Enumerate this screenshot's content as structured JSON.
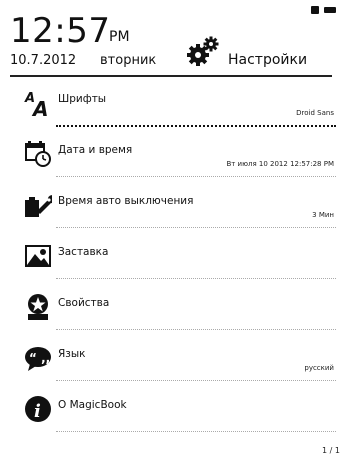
{
  "status": {
    "icons": [
      "tablet-icon",
      "battery-icon"
    ]
  },
  "clock": {
    "time": "12:57",
    "ampm": "PM"
  },
  "date": {
    "date": "10.7.2012",
    "weekday": "вторник"
  },
  "header": {
    "title": "Настройки",
    "icon": "gears-icon"
  },
  "menu": {
    "items": [
      {
        "label": "Шрифты",
        "value": "Droid Sans",
        "icon": "fonts-icon"
      },
      {
        "label": "Дата и время",
        "value": "Вт июля 10 2012 12:57:28 PM",
        "icon": "calendar-clock-icon"
      },
      {
        "label": "Время авто выключения",
        "value": "3 Мин",
        "icon": "battery-wrench-icon"
      },
      {
        "label": "Заставка",
        "value": "",
        "icon": "picture-icon"
      },
      {
        "label": "Свойства",
        "value": "",
        "icon": "star-badge-icon"
      },
      {
        "label": "Язык",
        "value": "русский",
        "icon": "speech-bubble-icon"
      },
      {
        "label": "O MagicBook",
        "value": "",
        "icon": "info-icon"
      }
    ]
  },
  "pagination": {
    "text": "1 / 1"
  }
}
